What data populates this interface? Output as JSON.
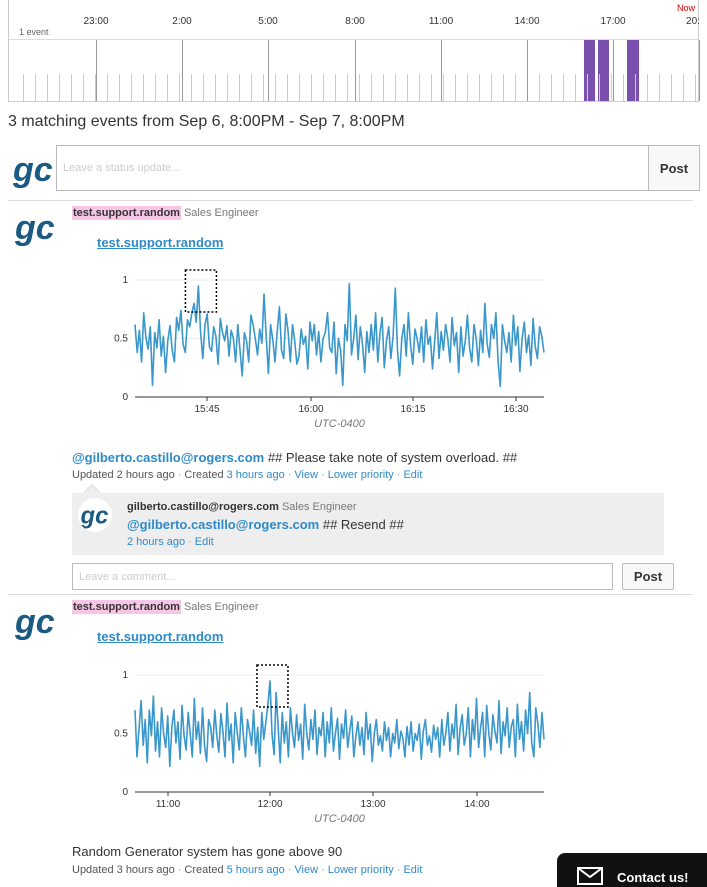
{
  "timeline": {
    "hours": [
      "23:00",
      "2:00",
      "5:00",
      "8:00",
      "11:00",
      "14:00",
      "17:00",
      "20:"
    ],
    "now_label": "Now",
    "event_count": "1 event",
    "event_bar_color": "#7b4fad"
  },
  "summary": "3 matching events from Sep 6, 8:00PM - Sep 7, 8:00PM",
  "status": {
    "placeholder": "Leave a status update...",
    "post_label": "Post"
  },
  "events": [
    {
      "user": "test.support.random",
      "role": "Sales Engineer",
      "title_link": "test.support.random",
      "text_mention": "@gilberto.castillo@rogers.com",
      "text_body": " ## Please take note of system overload. ##",
      "updated": "Updated 2 hours ago",
      "created_prefix": "Created ",
      "created_link": "3 hours ago",
      "actions": [
        "View",
        "Lower priority",
        "Edit"
      ],
      "comment": {
        "user": "gilberto.castillo@rogers.com",
        "role": "Sales Engineer",
        "mention": "@gilberto.castillo@rogers.com",
        "body": " ## Resend ##",
        "time": "2 hours ago",
        "edit": "Edit"
      },
      "comment_placeholder": "Leave a comment...",
      "comment_post_label": "Post"
    },
    {
      "user": "test.support.random",
      "role": "Sales Engineer",
      "title_link": "test.support.random",
      "text_body": "Random Generator system has gone above 90",
      "updated": "Updated 3 hours ago",
      "created_prefix": "Created ",
      "created_link": "5 hours ago",
      "actions": [
        "View",
        "Lower priority",
        "Edit"
      ]
    }
  ],
  "contact_label": "Contact us!",
  "chart_data": [
    {
      "type": "line",
      "x_ticks": [
        "15:45",
        "16:00",
        "16:15",
        "16:30"
      ],
      "y_ticks": [
        "0",
        "0.5",
        "1"
      ],
      "ylim": [
        0,
        1
      ],
      "xlabel": "UTC-0400",
      "color": "#3a97cc",
      "values": [
        0.62,
        0.38,
        0.57,
        0.3,
        0.72,
        0.51,
        0.41,
        0.6,
        0.1,
        0.55,
        0.42,
        0.66,
        0.35,
        0.52,
        0.21,
        0.48,
        0.61,
        0.4,
        0.3,
        0.68,
        0.57,
        0.74,
        0.45,
        0.38,
        0.66,
        0.6,
        0.72,
        0.8,
        0.64,
        0.95,
        0.55,
        0.33,
        0.62,
        0.71,
        0.43,
        0.39,
        0.6,
        0.52,
        0.28,
        0.67,
        0.55,
        0.48,
        0.61,
        0.35,
        0.57,
        0.5,
        0.3,
        0.62,
        0.4,
        0.18,
        0.55,
        0.48,
        0.3,
        0.7,
        0.62,
        0.5,
        0.36,
        0.58,
        0.46,
        0.88,
        0.52,
        0.2,
        0.62,
        0.49,
        0.3,
        0.56,
        0.77,
        0.4,
        0.33,
        0.71,
        0.56,
        0.3,
        0.62,
        0.48,
        0.28,
        0.35,
        0.58,
        0.45,
        0.52,
        0.24,
        0.64,
        0.48,
        0.62,
        0.36,
        0.56,
        0.3,
        0.5,
        0.55,
        0.72,
        0.42,
        0.38,
        0.64,
        0.2,
        0.5,
        0.4,
        0.1,
        0.62,
        0.48,
        0.97,
        0.36,
        0.5,
        0.7,
        0.32,
        0.6,
        0.45,
        0.21,
        0.56,
        0.38,
        0.62,
        0.4,
        0.72,
        0.3,
        0.55,
        0.68,
        0.25,
        0.48,
        0.6,
        0.33,
        0.52,
        0.93,
        0.4,
        0.18,
        0.5,
        0.62,
        0.35,
        0.72,
        0.44,
        0.28,
        0.58,
        0.5,
        0.38,
        0.6,
        0.3,
        0.66,
        0.45,
        0.52,
        0.24,
        0.47,
        0.72,
        0.33,
        0.56,
        0.4,
        0.62,
        0.5,
        0.3,
        0.68,
        0.44,
        0.55,
        0.21,
        0.6,
        0.35,
        0.48,
        0.7,
        0.42,
        0.3,
        0.62,
        0.5,
        0.27,
        0.57,
        0.38,
        0.8,
        0.46,
        0.34,
        0.62,
        0.5,
        0.72,
        0.3,
        0.09,
        0.62,
        0.48,
        0.38,
        0.55,
        0.3,
        0.7,
        0.44,
        0.6,
        0.22,
        0.5,
        0.64,
        0.38,
        0.53,
        0.27,
        0.67,
        0.43,
        0.33,
        0.6,
        0.52,
        0.38
      ]
    },
    {
      "type": "line",
      "x_ticks": [
        "11:00",
        "12:00",
        "13:00",
        "14:00"
      ],
      "y_ticks": [
        "0",
        "0.5",
        "1"
      ],
      "ylim": [
        0,
        1
      ],
      "xlabel": "UTC-0400",
      "color": "#3a97cc",
      "values": [
        0.7,
        0.3,
        0.55,
        0.78,
        0.4,
        0.62,
        0.25,
        0.7,
        0.48,
        0.82,
        0.35,
        0.6,
        0.3,
        0.72,
        0.5,
        0.38,
        0.65,
        0.22,
        0.55,
        0.7,
        0.42,
        0.6,
        0.28,
        0.74,
        0.48,
        0.36,
        0.68,
        0.5,
        0.3,
        0.8,
        0.45,
        0.6,
        0.33,
        0.72,
        0.4,
        0.26,
        0.62,
        0.55,
        0.38,
        0.7,
        0.48,
        0.34,
        0.67,
        0.52,
        0.3,
        0.76,
        0.44,
        0.58,
        0.25,
        0.68,
        0.5,
        0.36,
        0.72,
        0.48,
        0.3,
        0.62,
        0.52,
        0.4,
        0.7,
        0.33,
        0.55,
        0.22,
        0.68,
        0.45,
        0.6,
        0.75,
        0.95,
        0.5,
        0.32,
        0.85,
        0.55,
        0.25,
        0.68,
        0.42,
        0.6,
        0.3,
        0.72,
        0.5,
        0.38,
        0.66,
        0.44,
        0.58,
        0.28,
        0.75,
        0.5,
        0.36,
        0.62,
        0.45,
        0.7,
        0.32,
        0.55,
        0.48,
        0.68,
        0.3,
        0.6,
        0.42,
        0.72,
        0.35,
        0.5,
        0.63,
        0.28,
        0.58,
        0.46,
        0.7,
        0.38,
        0.52,
        0.65,
        0.3,
        0.48,
        0.6,
        0.4,
        0.55,
        0.32,
        0.68,
        0.45,
        0.58,
        0.26,
        0.5,
        0.62,
        0.4,
        0.48,
        0.35,
        0.6,
        0.44,
        0.55,
        0.3,
        0.5,
        0.42,
        0.62,
        0.37,
        0.52,
        0.46,
        0.3,
        0.56,
        0.4,
        0.6,
        0.35,
        0.5,
        0.44,
        0.58,
        0.28,
        0.52,
        0.62,
        0.4,
        0.48,
        0.34,
        0.57,
        0.45,
        0.55,
        0.3,
        0.62,
        0.4,
        0.5,
        0.68,
        0.35,
        0.58,
        0.46,
        0.75,
        0.32,
        0.55,
        0.66,
        0.4,
        0.5,
        0.72,
        0.3,
        0.62,
        0.45,
        0.8,
        0.38,
        0.55,
        0.68,
        0.3,
        0.74,
        0.5,
        0.36,
        0.66,
        0.52,
        0.42,
        0.78,
        0.33,
        0.6,
        0.48,
        0.72,
        0.38,
        0.56,
        0.62,
        0.3,
        0.75,
        0.45,
        0.6,
        0.35,
        0.7,
        0.5,
        0.85,
        0.42,
        0.3,
        0.72,
        0.58,
        0.38,
        0.68,
        0.45
      ]
    }
  ]
}
